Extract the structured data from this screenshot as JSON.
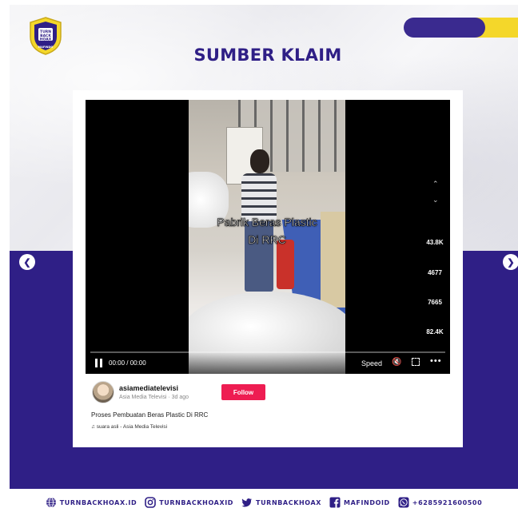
{
  "page": {
    "title": "SUMBER KLAIM",
    "logo_text": [
      "TURN",
      "BACK",
      "HOAX"
    ],
    "logo_ring_text": "MAFINDO",
    "colors": {
      "brand_purple": "#2f1f86",
      "accent_yellow": "#f4d72a",
      "follow_red": "#ee1d52"
    }
  },
  "nav": {
    "prev_icon": "chevron-left-icon",
    "next_icon": "chevron-right-icon"
  },
  "video": {
    "overlay_text": "Pabrik Beras Plastic Di RRC",
    "time": "00:00 / 00:00",
    "speed_label": "Speed",
    "stats": [
      "43.8K",
      "4677",
      "7665",
      "82.4K"
    ]
  },
  "post": {
    "username": "asiamediatelevisi",
    "subline": "Asia Media Televisi · 3d ago",
    "follow_label": "Follow",
    "caption": "Proses Pembuatan Beras Plastic Di RRC",
    "sound": "suara asli - Asia Media Televisi"
  },
  "footer": [
    {
      "icon": "globe-icon",
      "text": "TURNBACKHOAX.ID"
    },
    {
      "icon": "instagram-icon",
      "text": "TURNBACKHOAXID"
    },
    {
      "icon": "twitter-icon",
      "text": "TURNBACKHOAX"
    },
    {
      "icon": "facebook-icon",
      "text": "MAFINDOID"
    },
    {
      "icon": "whatsapp-icon",
      "text": "+6285921600500"
    }
  ]
}
